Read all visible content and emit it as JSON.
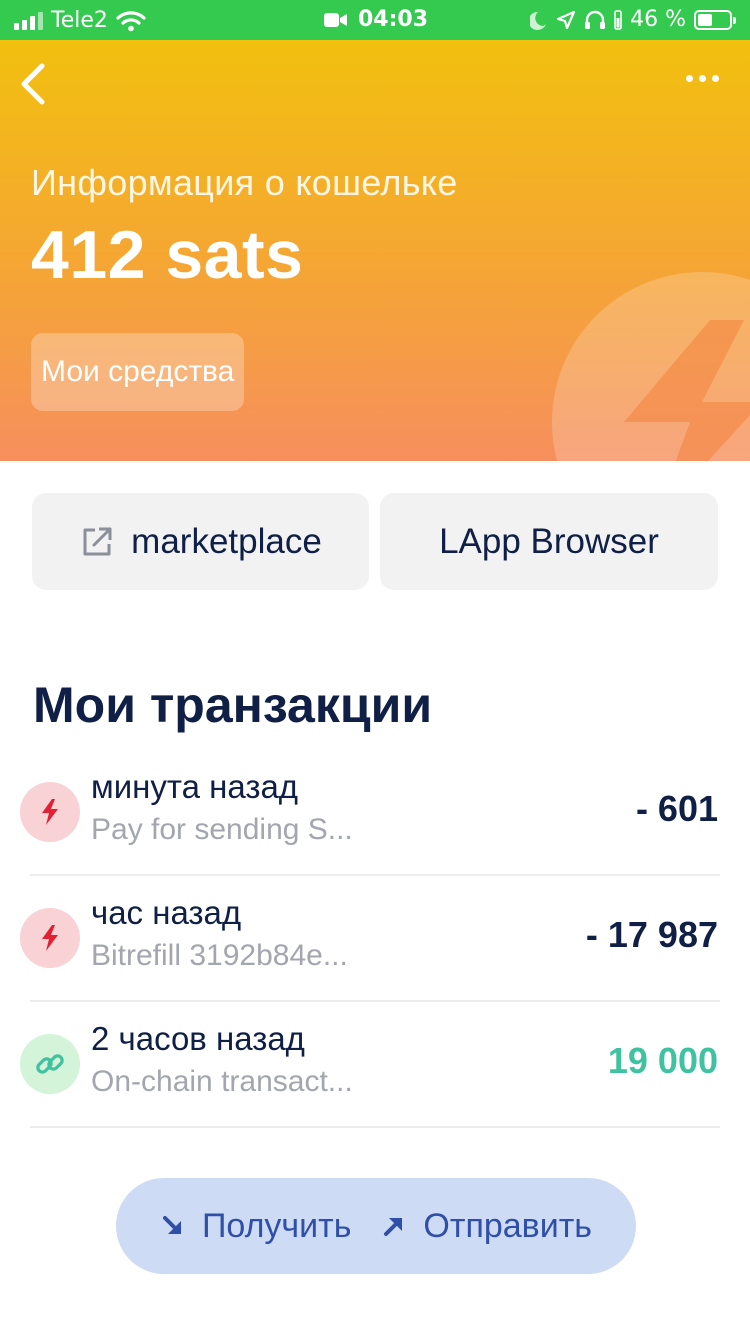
{
  "status_bar": {
    "carrier": "Tele2",
    "time": "04:03",
    "battery_percent": "46 %",
    "battery_level": 0.46,
    "icons": [
      "signal-icon",
      "wifi-icon",
      "video-icon",
      "moon-icon",
      "location-icon",
      "headphones-icon",
      "battery-icon"
    ]
  },
  "header": {
    "subtitle": "Информация о кошельке",
    "balance": "412 sats",
    "funds_button": "Мои средства",
    "gradient_colors": [
      "#f2c00e",
      "#f68f5e"
    ],
    "icons": [
      "chevron-left-icon",
      "more-icon",
      "lightning-icon"
    ]
  },
  "actions": {
    "marketplace": "marketplace",
    "lapp_browser": "LApp Browser"
  },
  "transactions": {
    "title": "Мои транзакции",
    "items": [
      {
        "time": "минута назад",
        "description": "Pay for sending S...",
        "amount": "- 601",
        "type": "lightning",
        "direction": "out"
      },
      {
        "time": "час назад",
        "description": "Bitrefill 3192b84e...",
        "amount": "- 17 987",
        "type": "lightning",
        "direction": "out"
      },
      {
        "time": "2 часов назад",
        "description": "On-chain transact...",
        "amount": "19 000",
        "type": "chain",
        "direction": "in"
      }
    ]
  },
  "bottom_bar": {
    "receive": "Получить",
    "send": "Отправить"
  },
  "colors": {
    "status_bar": "#34c94f",
    "text_dark": "#0f1f45",
    "amount_in": "#3fc2a0",
    "pill_bg": "#cddcf4",
    "pill_text": "#2f4fa8"
  }
}
